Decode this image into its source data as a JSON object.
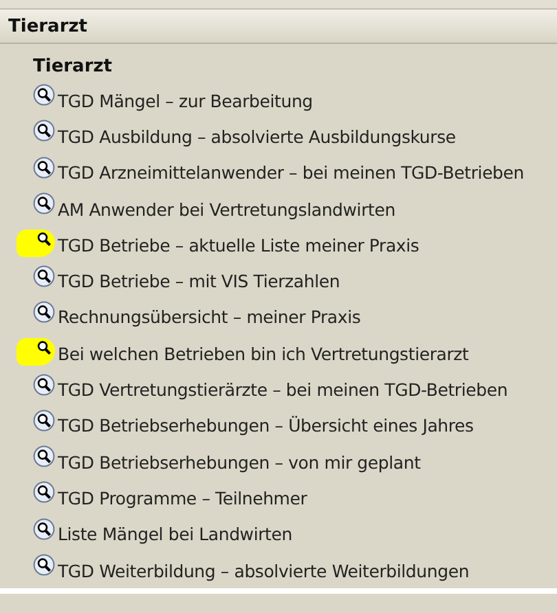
{
  "header": {
    "title": "Tierarzt"
  },
  "section": {
    "title": "Tierarzt"
  },
  "items": [
    {
      "label": "TGD Mängel – zur Bearbeitung",
      "highlighted": false
    },
    {
      "label": "TGD Ausbildung – absolvierte Ausbildungskurse",
      "highlighted": false
    },
    {
      "label": "TGD Arzneimittelanwender – bei meinen TGD-Betrieben",
      "highlighted": false
    },
    {
      "label": "AM Anwender bei Vertretungslandwirten",
      "highlighted": false
    },
    {
      "label": "TGD Betriebe – aktuelle Liste meiner Praxis",
      "highlighted": true
    },
    {
      "label": "TGD Betriebe – mit VIS Tierzahlen",
      "highlighted": false
    },
    {
      "label": "Rechnungsübersicht – meiner Praxis",
      "highlighted": false
    },
    {
      "label": "Bei welchen Betrieben bin ich Vertretungstierarzt",
      "highlighted": true
    },
    {
      "label": "TGD Vertretungstierärzte – bei meinen TGD-Betrieben",
      "highlighted": false
    },
    {
      "label": "TGD Betriebserhebungen – Übersicht eines Jahres",
      "highlighted": false
    },
    {
      "label": "TGD Betriebserhebungen – von mir geplant",
      "highlighted": false
    },
    {
      "label": "TGD Programme – Teilnehmer",
      "highlighted": false
    },
    {
      "label": "Liste Mängel bei Landwirten",
      "highlighted": false
    },
    {
      "label": "TGD Weiterbildung – absolvierte Weiterbildungen",
      "highlighted": false
    }
  ]
}
